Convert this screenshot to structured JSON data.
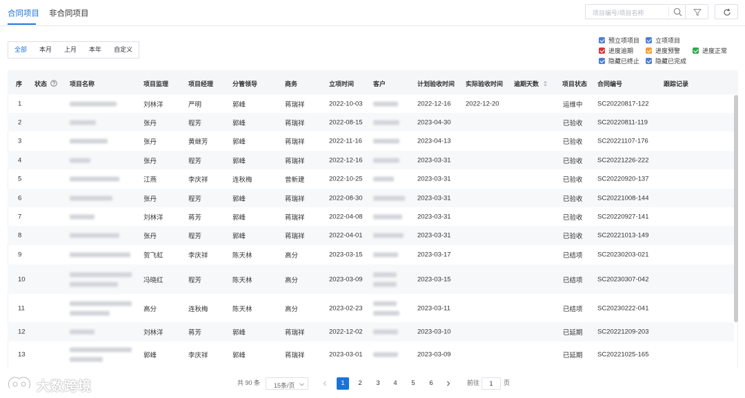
{
  "tabs": [
    {
      "label": "合同项目",
      "active": true
    },
    {
      "label": "非合同项目",
      "active": false
    }
  ],
  "search": {
    "placeholder": "项目编号/项目名称"
  },
  "icons": {
    "search": "search-icon",
    "filter": "filter-icon",
    "refresh": "refresh-icon",
    "status_help": "help-circle-icon",
    "sort": "sort-icon"
  },
  "date_filters": [
    {
      "label": "全部",
      "active": true
    },
    {
      "label": "本月"
    },
    {
      "label": "上月"
    },
    {
      "label": "本年"
    },
    {
      "label": "自定义"
    }
  ],
  "legend": [
    {
      "label": "预立项项目",
      "color": "#4a7fd6"
    },
    {
      "label": "立项项目",
      "color": "#4a7fd6"
    },
    {
      "label": "进度逾期",
      "color": "#d9363e"
    },
    {
      "label": "进度预警",
      "color": "#f0a030"
    },
    {
      "label": "进度正常",
      "color": "#2fa84f"
    },
    {
      "label": "隐藏已终止",
      "color": "#4a7fd6"
    },
    {
      "label": "隐藏已完成",
      "color": "#4a7fd6"
    }
  ],
  "columns": [
    "序",
    "状态",
    "项目名称",
    "项目监理",
    "项目经理",
    "分管领导",
    "商务",
    "立项时间",
    "客户",
    "计划验收时间",
    "实际验收时间",
    "逾期天数",
    "项目状态",
    "合同编号",
    "跟踪记录"
  ],
  "rows": [
    {
      "no": "1",
      "supervisor": "刘林洋",
      "manager": "严明",
      "leader": "郭峰",
      "business": "蒋瑞祥",
      "start": "2022-10-03",
      "planned": "2022-12-16",
      "actual": "2022-12-20",
      "status": "运维中",
      "contract": "SC20220817-122"
    },
    {
      "no": "2",
      "supervisor": "张丹",
      "manager": "程芳",
      "leader": "郭峰",
      "business": "蒋瑞祥",
      "start": "2022-08-15",
      "planned": "2023-04-30",
      "actual": "",
      "status": "已验收",
      "contract": "SC20220811-119"
    },
    {
      "no": "3",
      "supervisor": "张丹",
      "manager": "黄继芳",
      "leader": "郭峰",
      "business": "蒋瑞祥",
      "start": "2022-11-16",
      "planned": "2023-04-13",
      "actual": "",
      "status": "已验收",
      "contract": "SC20221107-176"
    },
    {
      "no": "4",
      "supervisor": "张丹",
      "manager": "程芳",
      "leader": "郭峰",
      "business": "蒋瑞祥",
      "start": "2022-12-16",
      "planned": "2023-03-31",
      "actual": "",
      "status": "已验收",
      "contract": "SC20221226-222"
    },
    {
      "no": "5",
      "supervisor": "江燕",
      "manager": "李庆祥",
      "leader": "连秋梅",
      "business": "曾新建",
      "start": "2022-10-25",
      "planned": "2023-03-31",
      "actual": "",
      "status": "已验收",
      "contract": "SC20220920-137"
    },
    {
      "no": "6",
      "supervisor": "张丹",
      "manager": "程芳",
      "leader": "郭峰",
      "business": "蒋瑞祥",
      "start": "2022-08-30",
      "planned": "2023-03-31",
      "actual": "",
      "status": "已验收",
      "contract": "SC20221008-144"
    },
    {
      "no": "7",
      "supervisor": "刘林洋",
      "manager": "蒋芳",
      "leader": "郭峰",
      "business": "蒋瑞祥",
      "start": "2022-04-08",
      "planned": "2023-03-31",
      "actual": "",
      "status": "已验收",
      "contract": "SC20220927-141"
    },
    {
      "no": "8",
      "supervisor": "张丹",
      "manager": "程芳",
      "leader": "郭峰",
      "business": "蒋瑞祥",
      "start": "2022-04-01",
      "planned": "2023-03-31",
      "actual": "",
      "status": "已验收",
      "contract": "SC20221013-149"
    },
    {
      "no": "9",
      "supervisor": "贺飞虹",
      "manager": "李庆祥",
      "leader": "陈天林",
      "business": "高分",
      "start": "2023-03-15",
      "planned": "2023-03-17",
      "actual": "",
      "status": "已结项",
      "contract": "SC20230203-021"
    },
    {
      "no": "10",
      "supervisor": "冯晓红",
      "manager": "程芳",
      "leader": "陈天林",
      "business": "高分",
      "start": "2023-03-09",
      "planned": "2023-03-15",
      "actual": "",
      "status": "已结项",
      "contract": "SC20230307-042"
    },
    {
      "no": "11",
      "supervisor": "高分",
      "manager": "连秋梅",
      "leader": "陈天林",
      "business": "高分",
      "start": "2023-02-23",
      "planned": "2023-03-11",
      "actual": "",
      "status": "已结项",
      "contract": "SC20230222-041"
    },
    {
      "no": "12",
      "supervisor": "刘林洋",
      "manager": "蒋芳",
      "leader": "郭峰",
      "business": "蒋瑞祥",
      "start": "2022-12-02",
      "planned": "2023-03-10",
      "actual": "",
      "status": "已延期",
      "contract": "SC20221209-203"
    },
    {
      "no": "13",
      "supervisor": "郭峰",
      "manager": "李庆祥",
      "leader": "郭峰",
      "business": "蒋瑞祥",
      "start": "2023-03-01",
      "planned": "2023-03-09",
      "actual": "",
      "status": "已延期",
      "contract": "SC20221025-165"
    }
  ],
  "pagination": {
    "total": "共 90 条",
    "page_size": "15条/页",
    "pages": [
      "1",
      "2",
      "3",
      "4",
      "5",
      "6"
    ],
    "current": "1",
    "goto_label": "前往",
    "goto_value": "1",
    "page_suffix": "页"
  },
  "watermark": {
    "text": "大数跨境"
  }
}
